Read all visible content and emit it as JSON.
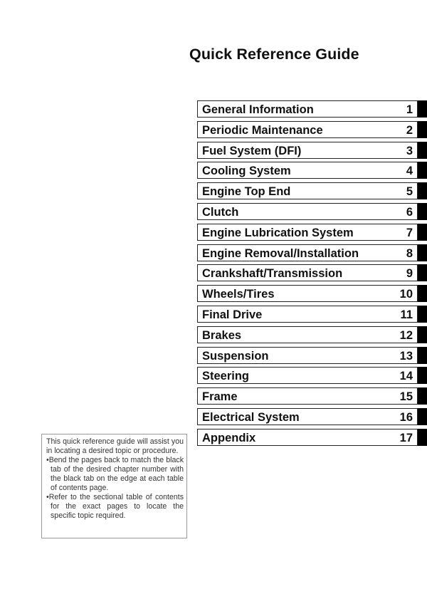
{
  "page": {
    "title": "Quick Reference Guide"
  },
  "toc": {
    "tab_color": "#000000",
    "items": [
      {
        "label": "General Information",
        "number": "1"
      },
      {
        "label": "Periodic Maintenance",
        "number": "2"
      },
      {
        "label": "Fuel System (DFI)",
        "number": "3"
      },
      {
        "label": "Cooling System",
        "number": "4"
      },
      {
        "label": "Engine Top End",
        "number": "5"
      },
      {
        "label": "Clutch",
        "number": "6"
      },
      {
        "label": "Engine Lubrication System",
        "number": "7"
      },
      {
        "label": "Engine Removal/Installation",
        "number": "8"
      },
      {
        "label": "Crankshaft/Transmission",
        "number": "9"
      },
      {
        "label": "Wheels/Tires",
        "number": "10"
      },
      {
        "label": "Final Drive",
        "number": "11"
      },
      {
        "label": "Brakes",
        "number": "12"
      },
      {
        "label": "Suspension",
        "number": "13"
      },
      {
        "label": "Steering",
        "number": "14"
      },
      {
        "label": "Frame",
        "number": "15"
      },
      {
        "label": "Electrical System",
        "number": "16"
      },
      {
        "label": "Appendix",
        "number": "17"
      }
    ]
  },
  "note": {
    "intro": "This quick reference guide will assist you in locating a desired topic or procedure.",
    "bullets": [
      "•Bend the pages back to match the black tab of the desired chapter number with the black tab on the edge at each table of contents page.",
      "•Refer to the sectional table of contents for the exact pages to locate the specific topic required."
    ]
  }
}
